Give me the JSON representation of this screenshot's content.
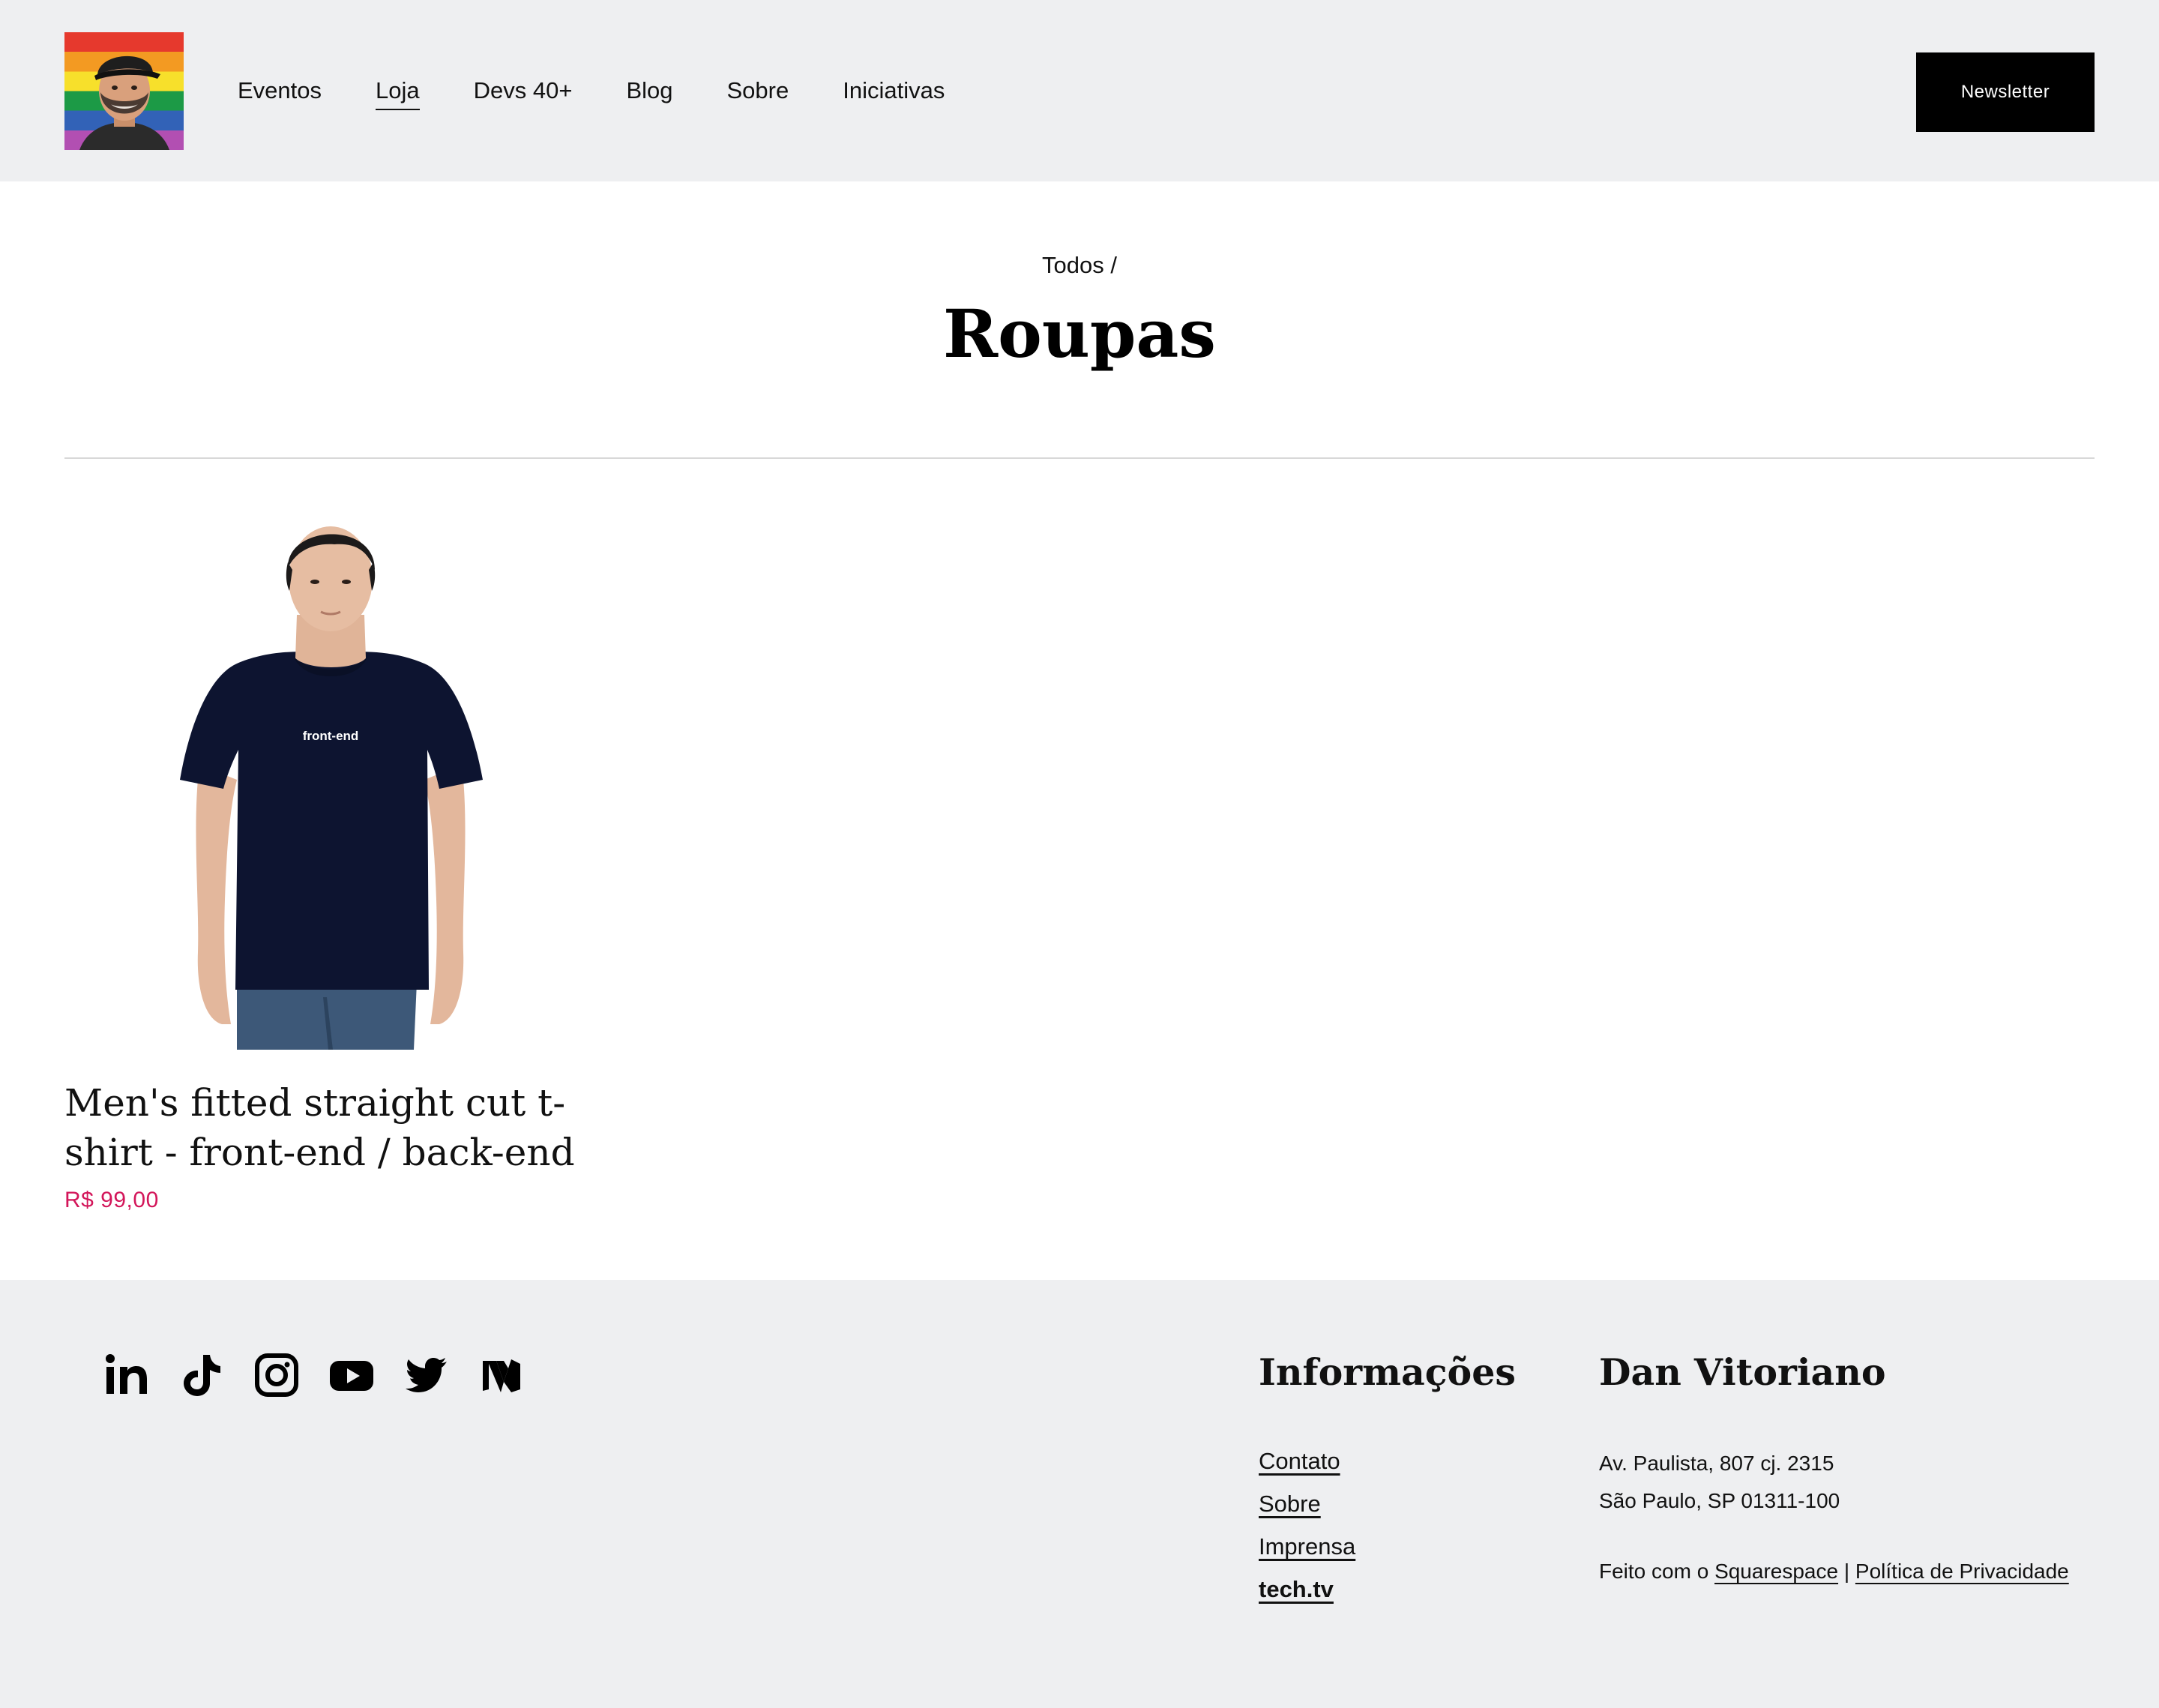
{
  "header": {
    "logo_alt": "Dan Vitoriano avatar",
    "nav": [
      {
        "label": "Eventos"
      },
      {
        "label": "Loja"
      },
      {
        "label": "Devs 40+"
      },
      {
        "label": "Blog"
      },
      {
        "label": "Sobre"
      },
      {
        "label": "Iniciativas"
      }
    ],
    "active_nav": "Loja",
    "newsletter_label": "Newsletter"
  },
  "page": {
    "breadcrumb": "Todos /",
    "title": "Roupas"
  },
  "product": {
    "title": "Men's fitted straight cut t-shirt - front-end / back-end",
    "price": "R$ 99,00",
    "shirt_print": "front-end"
  },
  "footer": {
    "social_icons": [
      "linkedin-icon",
      "tiktok-icon",
      "instagram-icon",
      "youtube-icon",
      "twitter-icon",
      "medium-icon"
    ],
    "info_heading": "Informações",
    "info_links": [
      {
        "label": "Contato"
      },
      {
        "label": "Sobre"
      },
      {
        "label": "Imprensa"
      },
      {
        "label": "tech.tv"
      }
    ],
    "name_heading": "Dan Vitoriano",
    "address_line1": "Av. Paulista, 807 cj. 2315",
    "address_line2": "São Paulo, SP 01311-100",
    "credits_prefix": "Feito com o",
    "credits_link": "Squarespace",
    "credits_separator": "|",
    "privacy_link": "Política de Privacidade"
  },
  "colors": {
    "header_bg": "#eeeff1",
    "price": "#d3165a",
    "button_bg": "#000000"
  }
}
